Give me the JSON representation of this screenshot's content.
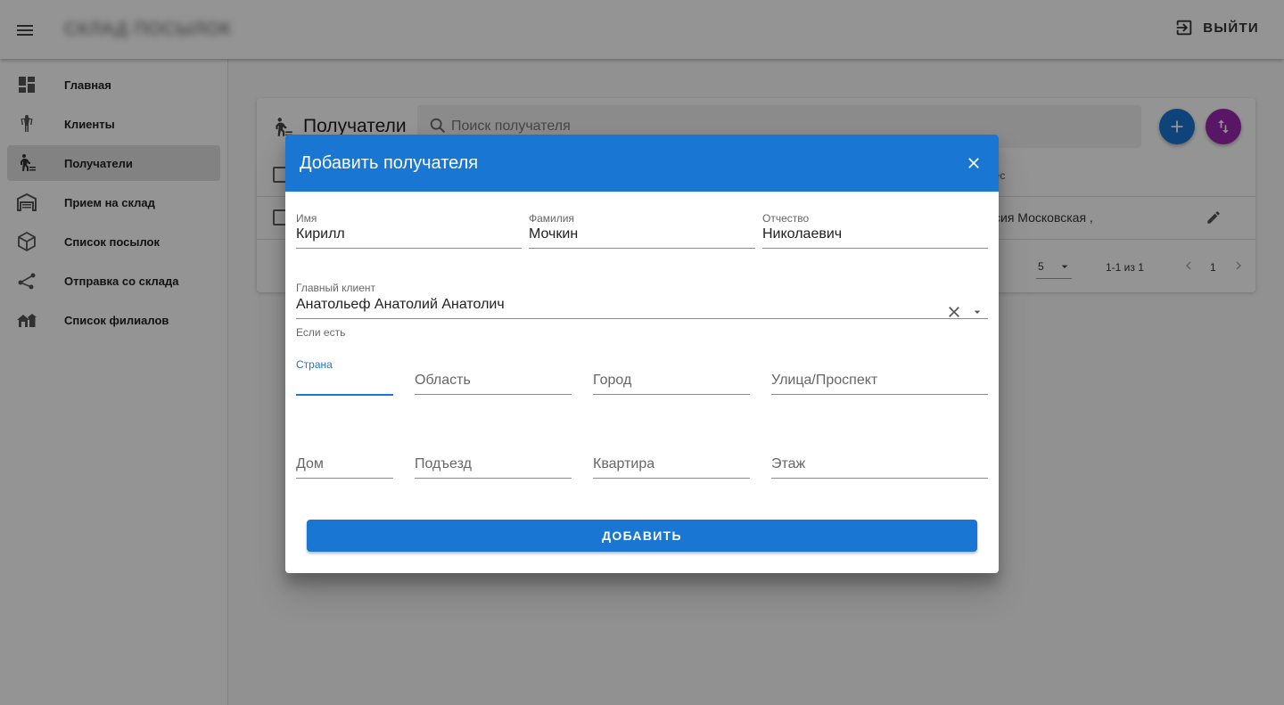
{
  "app": {
    "brand": "СКЛАД ПОСЫЛОК",
    "logout_label": "ВЫЙТИ"
  },
  "sidebar": {
    "items": [
      {
        "label": "Главная",
        "icon": "dashboard-icon"
      },
      {
        "label": "Клиенты",
        "icon": "person-icon"
      },
      {
        "label": "Получатели",
        "icon": "recipients-icon",
        "active": true
      },
      {
        "label": "Прием на склад",
        "icon": "warehouse-icon"
      },
      {
        "label": "Список посылок",
        "icon": "package-icon"
      },
      {
        "label": "Отправка со склада",
        "icon": "route-icon"
      },
      {
        "label": "Список филиалов",
        "icon": "branches-icon"
      }
    ]
  },
  "card": {
    "title": "Получатели",
    "search_placeholder": "Поиск получателя",
    "column_address_fragment": "рес",
    "row_address_fragment": "ссия Московская ,",
    "rows_per_page_label_fragment": "е:",
    "rows_per_page_value": "5",
    "range_text": "1-1 из 1",
    "page_number": "1"
  },
  "dialog": {
    "title": "Добавить получателя",
    "fields": {
      "first_name": {
        "label": "Имя",
        "value": "Кирилл"
      },
      "last_name": {
        "label": "Фамилия",
        "value": "Мочкин"
      },
      "patronymic": {
        "label": "Отчество",
        "value": "Николаевич"
      },
      "main_client": {
        "label": "Главный клиент",
        "value": "Анатольеф Анатолий Анатолич",
        "helper": "Если есть"
      },
      "country": {
        "label": "Страна",
        "value": ""
      },
      "region": {
        "placeholder": "Область"
      },
      "city": {
        "placeholder": "Город"
      },
      "street": {
        "placeholder": "Улица/Проспект"
      },
      "house": {
        "placeholder": "Дом"
      },
      "entrance": {
        "placeholder": "Подъезд"
      },
      "apartment": {
        "placeholder": "Квартира"
      },
      "floor": {
        "placeholder": "Этаж"
      }
    },
    "submit_label": "ДОБАВИТЬ"
  },
  "colors": {
    "primary": "#1976d2",
    "secondary": "#9c27b0",
    "overlay": "rgba(0,0,0,0.42)"
  }
}
